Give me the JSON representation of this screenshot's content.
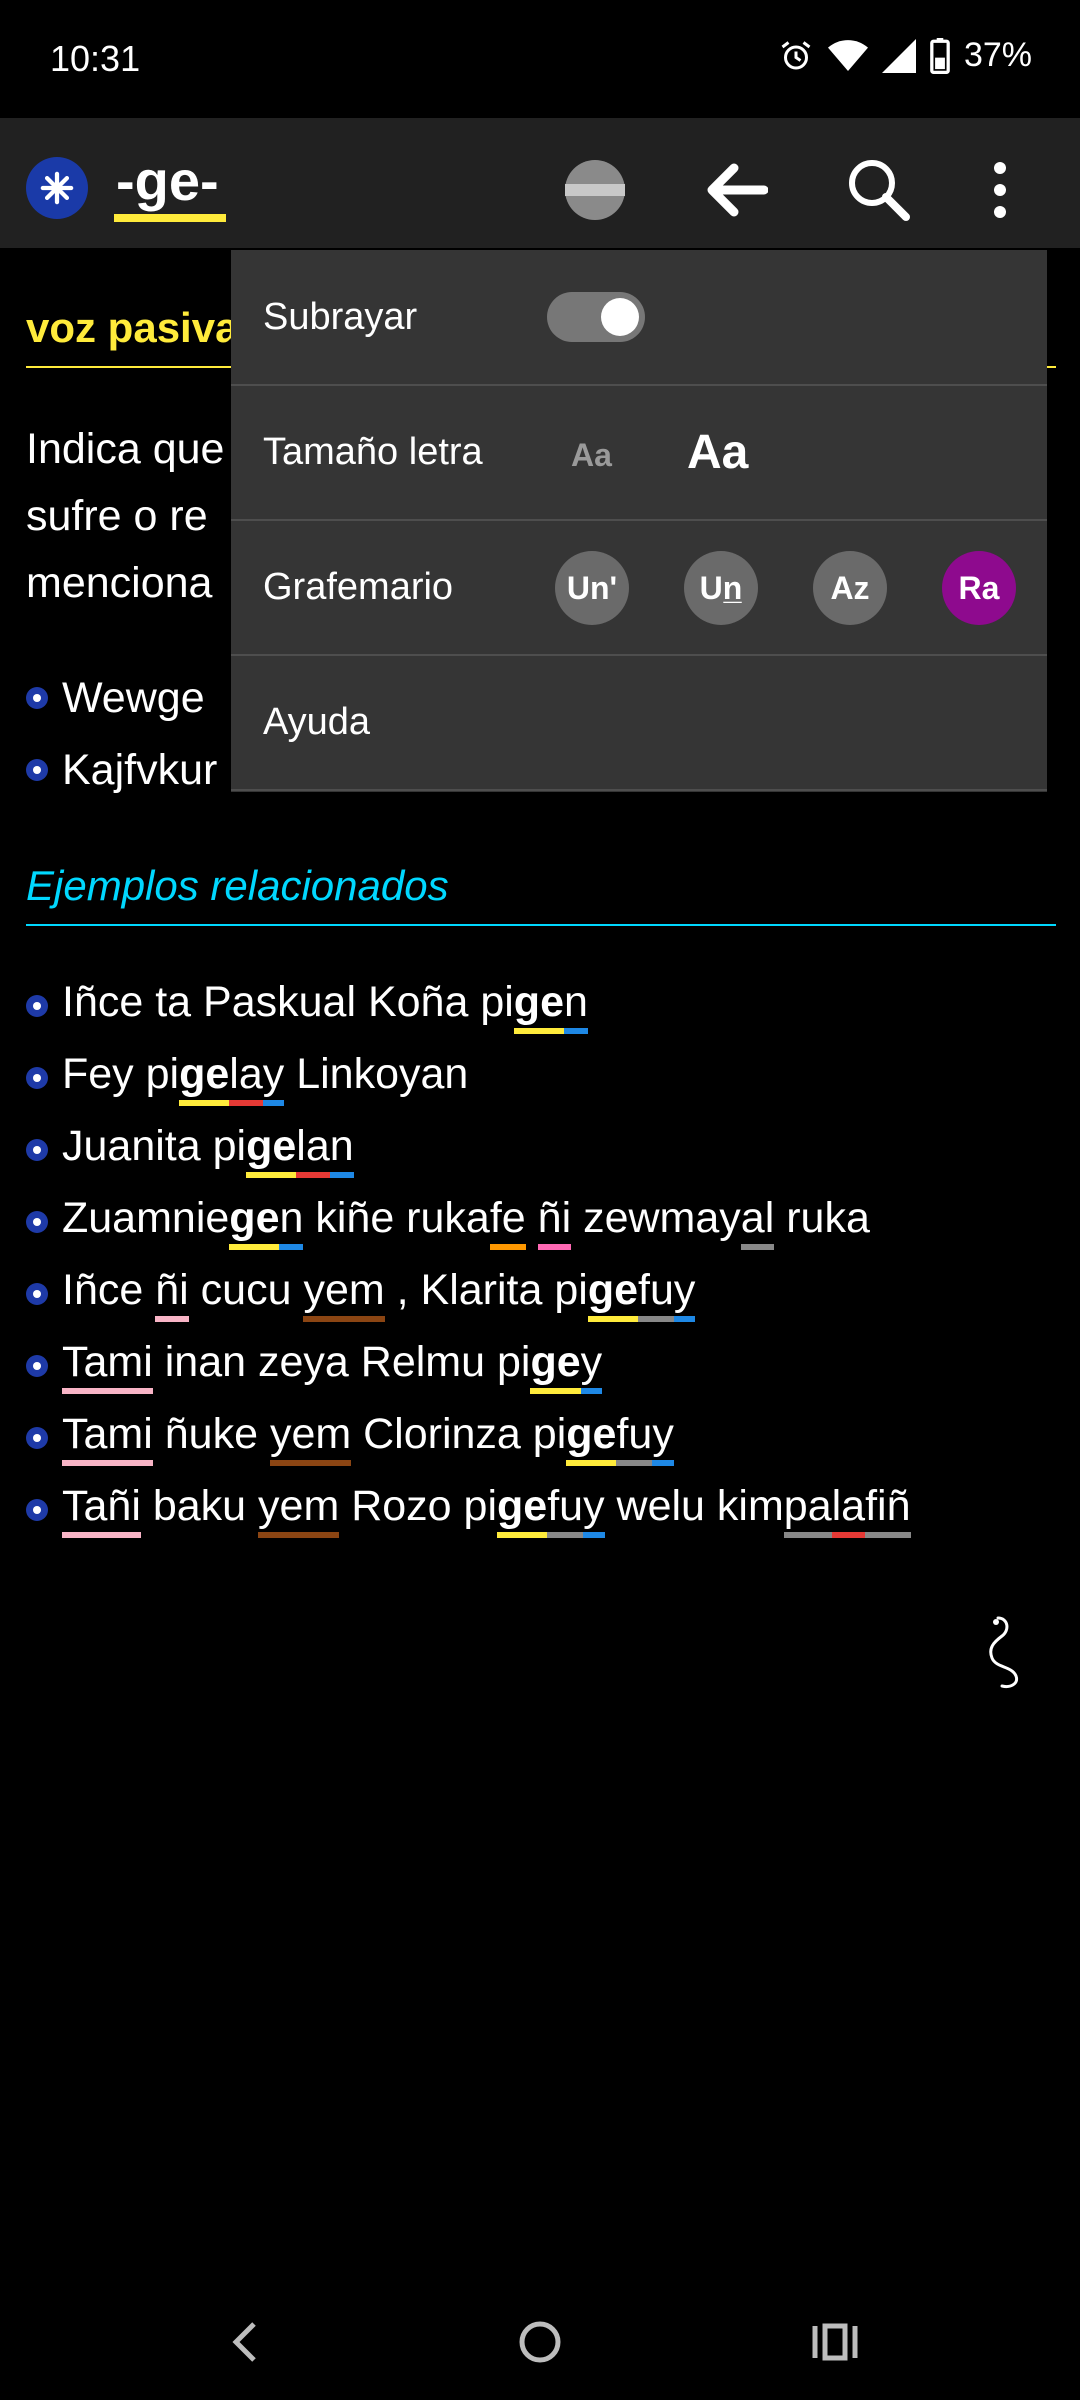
{
  "status_bar": {
    "time": "10:31",
    "battery": "37%"
  },
  "app_bar": {
    "title": "-ge-"
  },
  "section1": {
    "heading": "voz pasiva",
    "paragraph_lines": [
      "Indica que",
      "sufre o re",
      "menciona"
    ],
    "examples": [
      "Wewge",
      "Kajfvkur"
    ]
  },
  "section2": {
    "heading": "Ejemplos relacionados",
    "examples": [
      {
        "segments": [
          {
            "t": "Iñce ta Paskual Koña pi"
          },
          {
            "t": "ge",
            "u": "y",
            "b": true
          },
          {
            "t": "n",
            "u": "b"
          }
        ]
      },
      {
        "segments": [
          {
            "t": "Fey pi"
          },
          {
            "t": "ge",
            "u": "y",
            "b": true
          },
          {
            "t": "la",
            "u": "r"
          },
          {
            "t": "y",
            "u": "b"
          },
          {
            "t": " Linkoyan"
          }
        ]
      },
      {
        "segments": [
          {
            "t": "Juanita pi"
          },
          {
            "t": "ge",
            "u": "y",
            "b": true
          },
          {
            "t": "la",
            "u": "r"
          },
          {
            "t": "n",
            "u": "b"
          },
          {
            "t": ""
          }
        ]
      },
      {
        "segments": [
          {
            "t": "Zuamnie"
          },
          {
            "t": "ge",
            "u": "y",
            "b": true
          },
          {
            "t": "n",
            "u": "b"
          },
          {
            "t": " kiñe ruka"
          },
          {
            "t": "fe",
            "u": "o"
          },
          {
            "t": " "
          },
          {
            "t": "ñi",
            "u": "p"
          },
          {
            "t": " zewmay"
          },
          {
            "t": "al",
            "u": "g"
          },
          {
            "t": " ruka"
          }
        ]
      },
      {
        "segments": [
          {
            "t": "Iñce "
          },
          {
            "t": "ñi",
            "u": "lp"
          },
          {
            "t": " cucu "
          },
          {
            "t": "yem",
            "u": "br"
          },
          {
            "t": " , Klarita pi"
          },
          {
            "t": "ge",
            "u": "y",
            "b": true
          },
          {
            "t": "fu",
            "u": "g"
          },
          {
            "t": "y",
            "u": "b"
          }
        ]
      },
      {
        "segments": [
          {
            "t": "Tami",
            "u": "lp"
          },
          {
            "t": " inan zeya Relmu pi"
          },
          {
            "t": "ge",
            "u": "y",
            "b": true
          },
          {
            "t": "y",
            "u": "b"
          }
        ]
      },
      {
        "segments": [
          {
            "t": "Tami",
            "u": "lp"
          },
          {
            "t": " ñuke "
          },
          {
            "t": "yem",
            "u": "br"
          },
          {
            "t": " Clorinza pi"
          },
          {
            "t": "ge",
            "u": "y",
            "b": true
          },
          {
            "t": "fu",
            "u": "g"
          },
          {
            "t": "y",
            "u": "b"
          }
        ]
      },
      {
        "segments": [
          {
            "t": "Tañi",
            "u": "lp"
          },
          {
            "t": " baku "
          },
          {
            "t": "yem",
            "u": "br"
          },
          {
            "t": " Rozo pi"
          },
          {
            "t": "ge",
            "u": "y",
            "b": true
          },
          {
            "t": "fu",
            "u": "g"
          },
          {
            "t": "y",
            "u": "b"
          },
          {
            "t": " welu kim"
          },
          {
            "t": "pa",
            "u": "g"
          },
          {
            "t": "la",
            "u": "r"
          },
          {
            "t": "fiñ",
            "u": "g"
          }
        ]
      }
    ]
  },
  "menu": {
    "underline_label": "Subrayar",
    "underline_on": true,
    "font_size_label": "Tamaño letra",
    "font_small": "Aa",
    "font_large": "Aa",
    "grafemario_label": "Grafemario",
    "grafemario_options": [
      "Un'",
      "Un̲",
      "Az",
      "Ra"
    ],
    "grafemario_selected": "Ra",
    "help_label": "Ayuda"
  },
  "colors": {
    "accent_yellow": "#ffeb3b",
    "heading_cyan": "#00d8ff",
    "menu_bg": "#353535",
    "selected_purple": "#8e0a8e"
  }
}
